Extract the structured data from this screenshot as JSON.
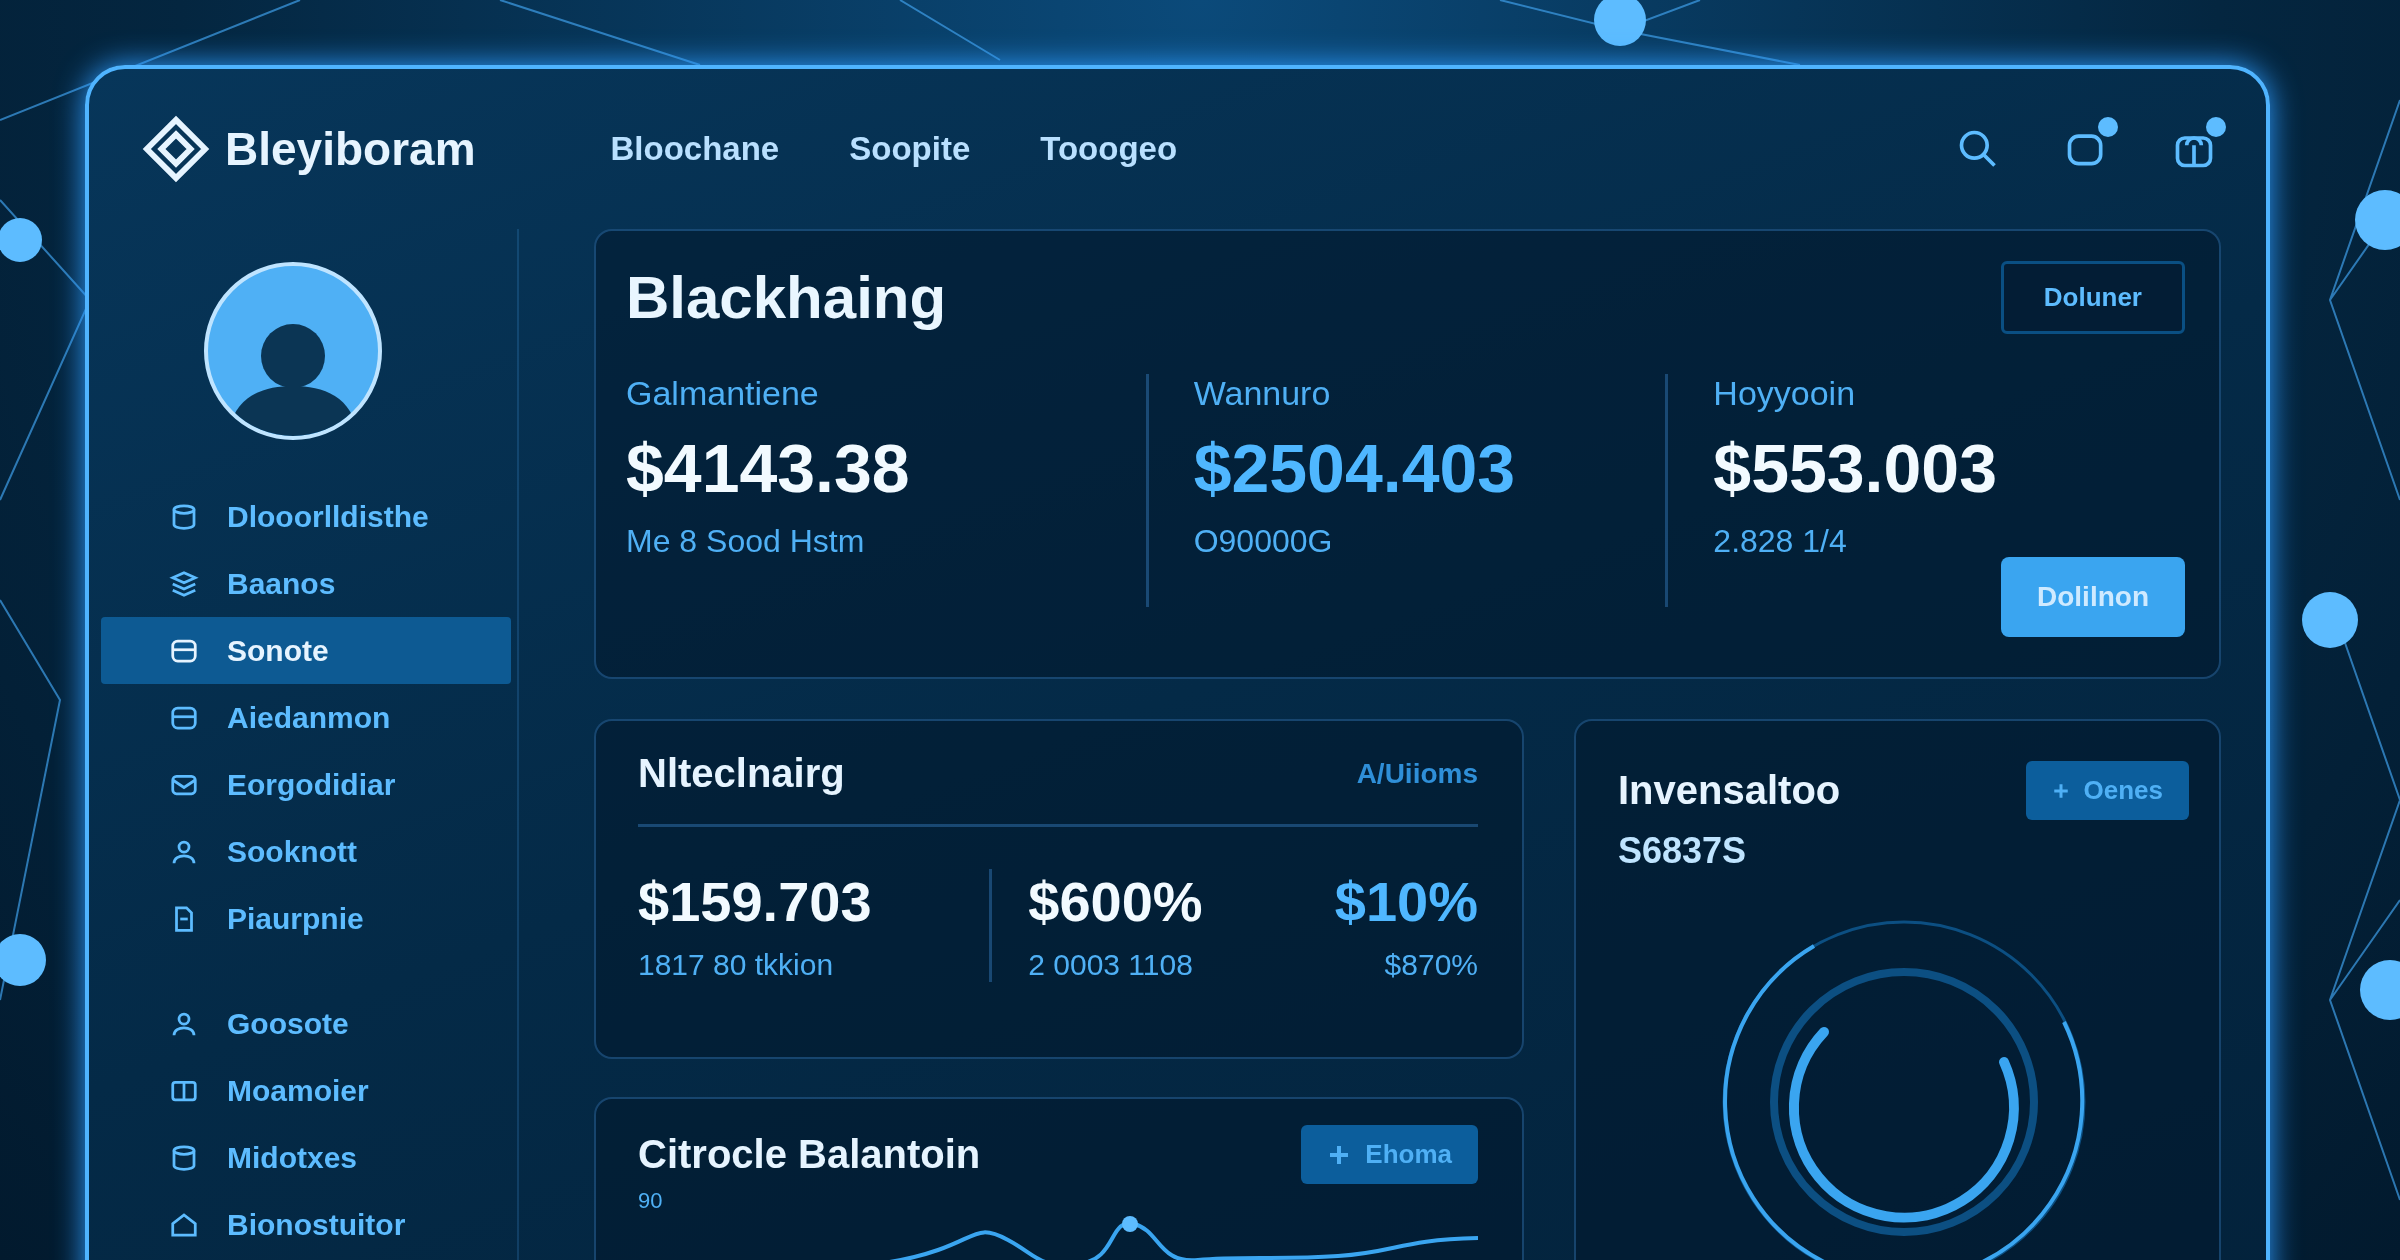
{
  "header": {
    "brand": "Bleyiboram",
    "nav": [
      {
        "label": "Bloochane"
      },
      {
        "label": "Soopite"
      },
      {
        "label": "Tooogeo"
      }
    ],
    "actions": [
      {
        "kind": "search"
      },
      {
        "kind": "chat",
        "badge": true
      },
      {
        "kind": "bag",
        "badge": true
      }
    ]
  },
  "sidebar": {
    "items": [
      {
        "label": "Dlooorlldisthe",
        "selected": false
      },
      {
        "label": "Baanos",
        "selected": false
      },
      {
        "label": "Sonote",
        "selected": true
      },
      {
        "label": "Aiedanmon",
        "selected": false
      },
      {
        "label": "Eorgodidiar",
        "selected": false
      },
      {
        "label": "Sooknott",
        "selected": false
      },
      {
        "label": "Piaurpnie",
        "selected": false
      }
    ],
    "more_items": [
      {
        "label": "Goosote",
        "selected": false
      },
      {
        "label": "Moamoier",
        "selected": false
      },
      {
        "label": "Midotxes",
        "selected": false
      },
      {
        "label": "Bionostuitor",
        "selected": false
      }
    ]
  },
  "overview": {
    "title": "Blackhaing",
    "button": "Doluner",
    "stats": [
      {
        "label": "Galmantiene",
        "value": "$4143.38",
        "note": "Me 8 Sood Hstm",
        "accent": false
      },
      {
        "label": "Wannuro",
        "value": "$2504.403",
        "note": "O90000G",
        "accent": true
      },
      {
        "label": "Hoyyooin",
        "value": "$553.003",
        "note": "2.828 1/4",
        "accent": false
      }
    ],
    "primary_button": "Dolilnon"
  },
  "metrics": {
    "title": "Nlteclnairg",
    "link": "A/Uiioms",
    "columns": [
      {
        "value": "$159.703",
        "note": "1817 80 tkkion",
        "accent": false
      },
      {
        "value": "$600%",
        "note": "2 0003 1108",
        "accent": false
      },
      {
        "value": "$10%",
        "note": "$870%",
        "accent": true
      }
    ]
  },
  "transactions": {
    "title": "Invensaltoo",
    "amount": "S6837S",
    "button": "Oenes"
  },
  "balance": {
    "title": "Citrocle Balantoin",
    "button": "Ehoma",
    "axis_label": "90"
  }
}
